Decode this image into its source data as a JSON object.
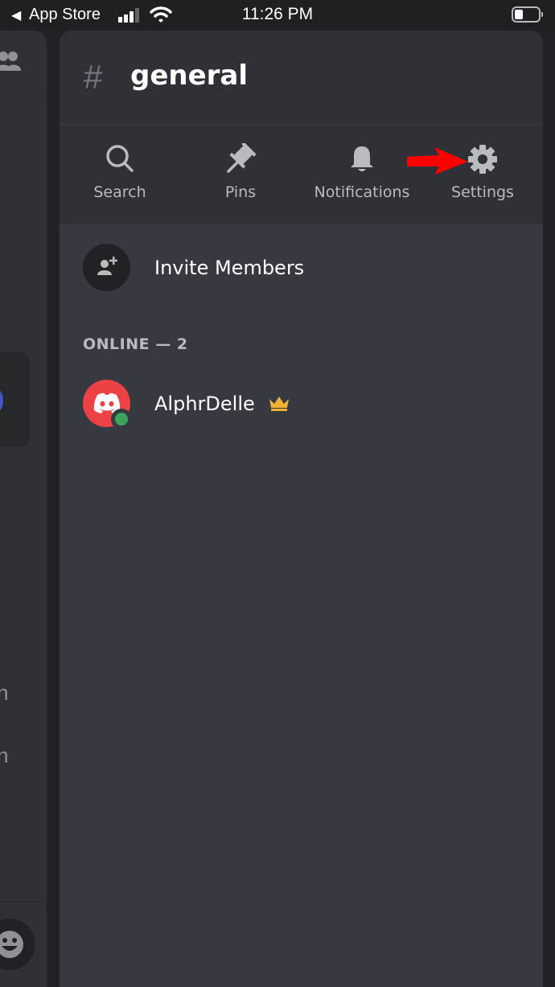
{
  "status_bar": {
    "back_app": "App Store",
    "time": "11:26 PM"
  },
  "left_column": {
    "partial_texts": [
      "n",
      "n"
    ]
  },
  "channel": {
    "hash_symbol": "#",
    "name": "general"
  },
  "actions": [
    {
      "label": "Search",
      "icon": "search-icon"
    },
    {
      "label": "Pins",
      "icon": "pin-icon"
    },
    {
      "label": "Notifications",
      "icon": "bell-icon"
    },
    {
      "label": "Settings",
      "icon": "gear-icon"
    }
  ],
  "invite": {
    "label": "Invite Members"
  },
  "members": {
    "section_label": "ONLINE — 2",
    "list": [
      {
        "name": "AlphrDelle",
        "status": "online",
        "is_owner": true
      }
    ]
  },
  "colors": {
    "accent_arrow": "#ff0000",
    "online": "#3ba55d",
    "avatar_bg": "#ed4245",
    "crown": "#f0b232"
  }
}
